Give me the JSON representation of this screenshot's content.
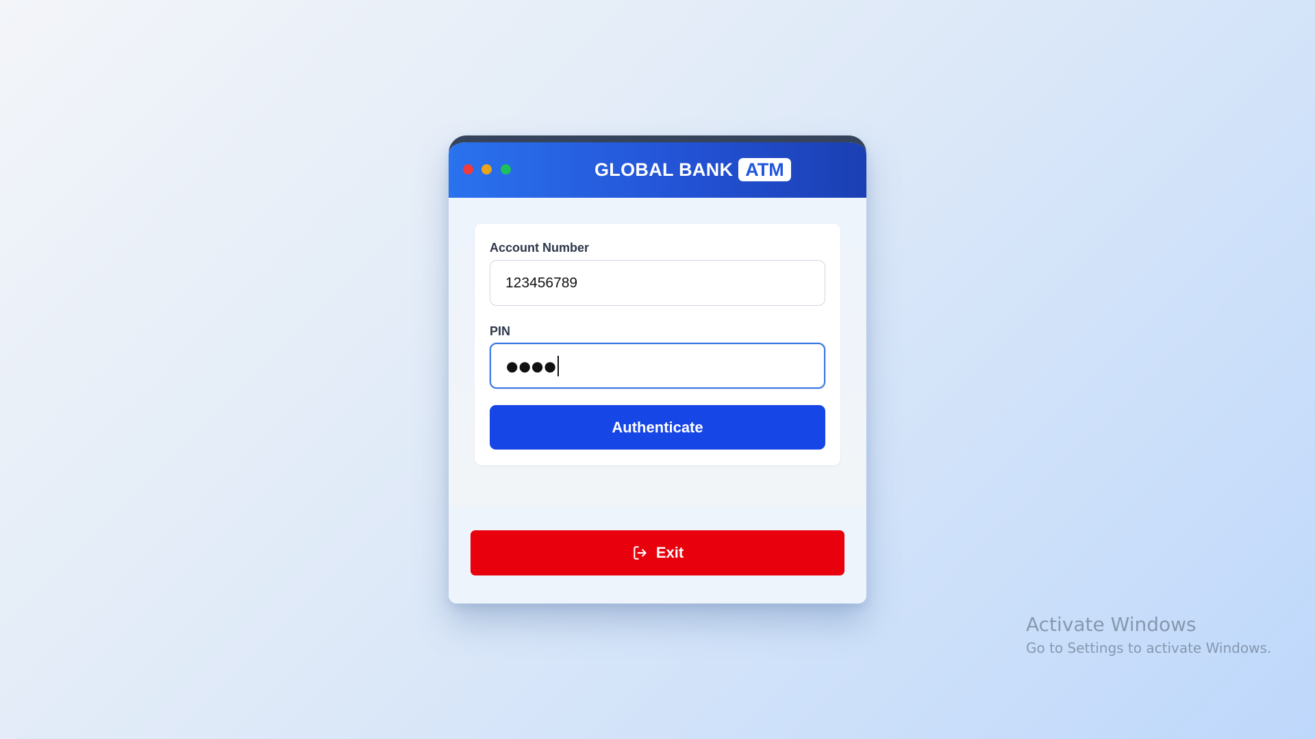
{
  "window": {
    "brand_name": "GLOBAL BANK",
    "brand_badge": "ATM",
    "controls": [
      "close",
      "minimize",
      "maximize"
    ]
  },
  "login": {
    "account_label": "Account Number",
    "account_value": "123456789",
    "pin_label": "PIN",
    "pin_masked": "●●●●",
    "authenticate_label": "Authenticate"
  },
  "footer": {
    "exit_label": "Exit",
    "exit_icon": "sign-out-icon"
  },
  "watermark": {
    "title": "Activate Windows",
    "subtitle": "Go to Settings to activate Windows."
  },
  "colors": {
    "header_blue": "#2353d6",
    "authenticate_blue": "#1746e6",
    "exit_red": "#e8000c",
    "focus_ring": "#3a78e0"
  }
}
